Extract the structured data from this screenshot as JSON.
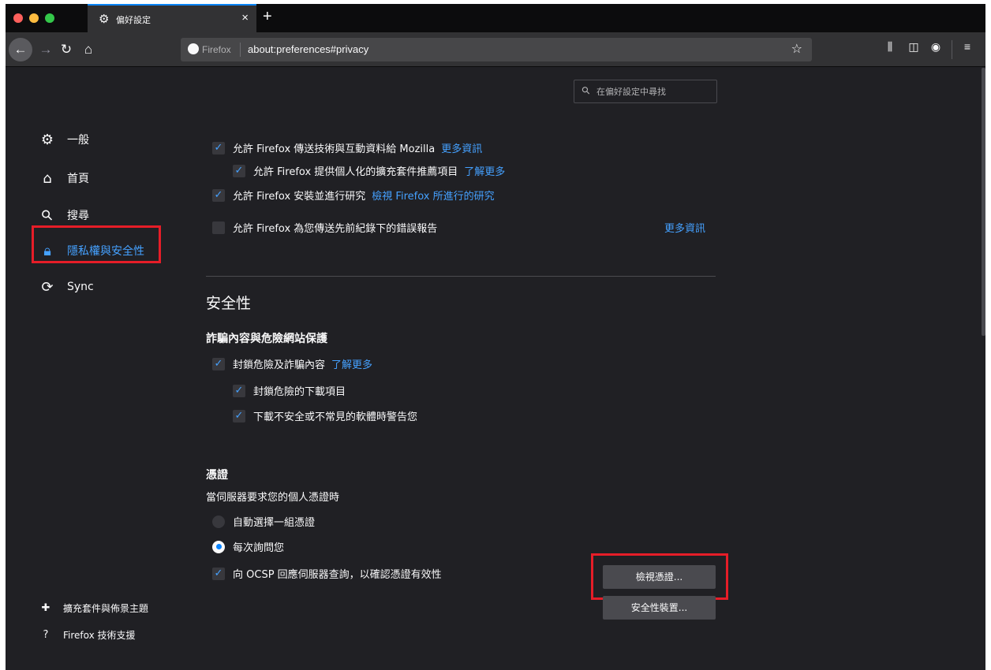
{
  "tab": {
    "title": "偏好設定",
    "close": "×",
    "new": "+"
  },
  "navbar": {
    "identity_label": "Firefox",
    "url": "about:preferences#privacy"
  },
  "search": {
    "placeholder": "在偏好設定中尋找"
  },
  "sidebar": {
    "items": [
      {
        "label": "一般",
        "icon": "gear-icon"
      },
      {
        "label": "首頁",
        "icon": "home-icon"
      },
      {
        "label": "搜尋",
        "icon": "search-icon"
      },
      {
        "label": "隱私權與安全性",
        "icon": "lock-icon",
        "selected": true
      },
      {
        "label": "Sync",
        "icon": "sync-icon"
      }
    ],
    "bottom": [
      {
        "label": "擴充套件與佈景主題",
        "icon": "puzzle-icon"
      },
      {
        "label": "Firefox 技術支援",
        "icon": "help-icon"
      }
    ]
  },
  "data_collection": {
    "items": [
      {
        "label": "允許 Firefox 傳送技術與互動資料給 Mozilla",
        "link": "更多資訊",
        "checked": true
      },
      {
        "label": "允許 Firefox 提供個人化的擴充套件推薦項目",
        "link": "了解更多",
        "checked": true
      },
      {
        "label": "允許 Firefox 安裝並進行研究",
        "link": "檢視 Firefox 所進行的研究",
        "checked": true
      },
      {
        "label": "允許 Firefox 為您傳送先前紀錄下的錯誤報告",
        "link": "更多資訊",
        "checked": false
      }
    ]
  },
  "security": {
    "title": "安全性",
    "protection_heading": "詐騙內容與危險網站保護",
    "block_dangerous": {
      "label": "封鎖危險及詐騙內容",
      "link": "了解更多",
      "checked": true
    },
    "block_downloads": {
      "label": "封鎖危險的下載項目",
      "checked": true
    },
    "warn_software": {
      "label": "下載不安全或不常見的軟體時警告您",
      "checked": true
    },
    "certs_heading": "憑證",
    "certs_prompt": "當伺服器要求您的個人憑證時",
    "radio_auto": {
      "label": "自動選擇一組憑證",
      "selected": false
    },
    "radio_ask": {
      "label": "每次詢問您",
      "selected": true
    },
    "ocsp": {
      "label": "向 OCSP 回應伺服器查詢，以確認憑證有效性",
      "checked": true
    },
    "view_certs_button": "檢視憑證...",
    "security_devices_button": "安全性裝置..."
  },
  "colors": {
    "accent": "#45a1ff",
    "highlight": "#e61d28",
    "background": "#202024"
  }
}
